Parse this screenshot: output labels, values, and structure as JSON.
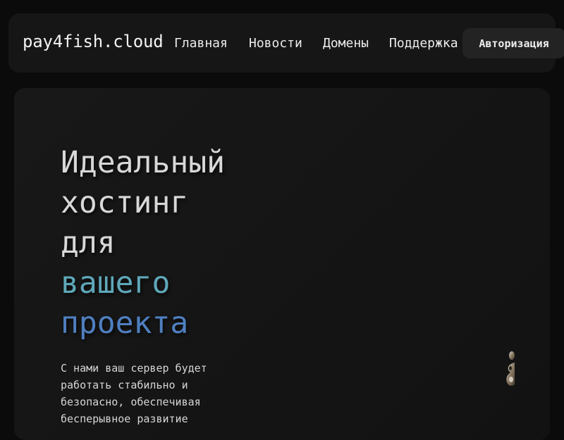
{
  "brand": "pay4fish.cloud",
  "nav": {
    "home": "Главная",
    "news": "Новости",
    "domains": "Домены",
    "support": "Поддержка"
  },
  "auth_button": "Авторизация",
  "hero": {
    "title_line1": "Идеальный",
    "title_line2": "хостинг",
    "title_line3": "для",
    "title_line4": "вашего",
    "title_line5": "проекта",
    "description": "С нами ваш сервер будет работать стабильно и безопасно, обеспечивая бесперывное развитие",
    "accent_colors": [
      "#5fa8ba",
      "#4f7fc0"
    ]
  }
}
